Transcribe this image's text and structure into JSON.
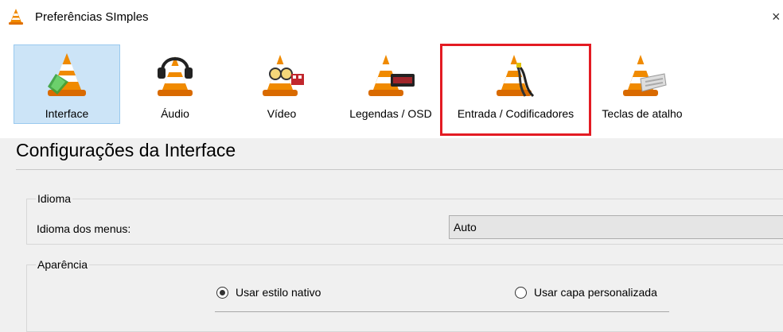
{
  "window": {
    "title": "Preferências SImples",
    "close_glyph": "×"
  },
  "toolbar": {
    "items": [
      {
        "label": "Interface",
        "icon": "vlc-cone-interface-icon",
        "selected": true
      },
      {
        "label": "Áudio",
        "icon": "vlc-cone-headphones-icon"
      },
      {
        "label": "Vídeo",
        "icon": "vlc-cone-glasses-icon"
      },
      {
        "label": "Legendas / OSD",
        "icon": "vlc-cone-subtitles-icon"
      },
      {
        "label": "Entrada / Codificadores",
        "icon": "vlc-cone-cables-icon",
        "highlighted": true
      },
      {
        "label": "Teclas de atalho",
        "icon": "vlc-cone-keyboard-icon"
      }
    ]
  },
  "section": {
    "title": "Configurações da Interface"
  },
  "language_group": {
    "legend": "Idioma",
    "menu_language_label": "Idioma dos menus:",
    "menu_language_value": "Auto"
  },
  "appearance_group": {
    "legend": "Aparência",
    "native_style_label": "Usar estilo nativo",
    "custom_skin_label": "Usar capa personalizada",
    "selected": "native"
  },
  "colors": {
    "highlight": "#e31b23",
    "selected_bg": "#cce4f7",
    "cone_orange": "#f08a00"
  }
}
